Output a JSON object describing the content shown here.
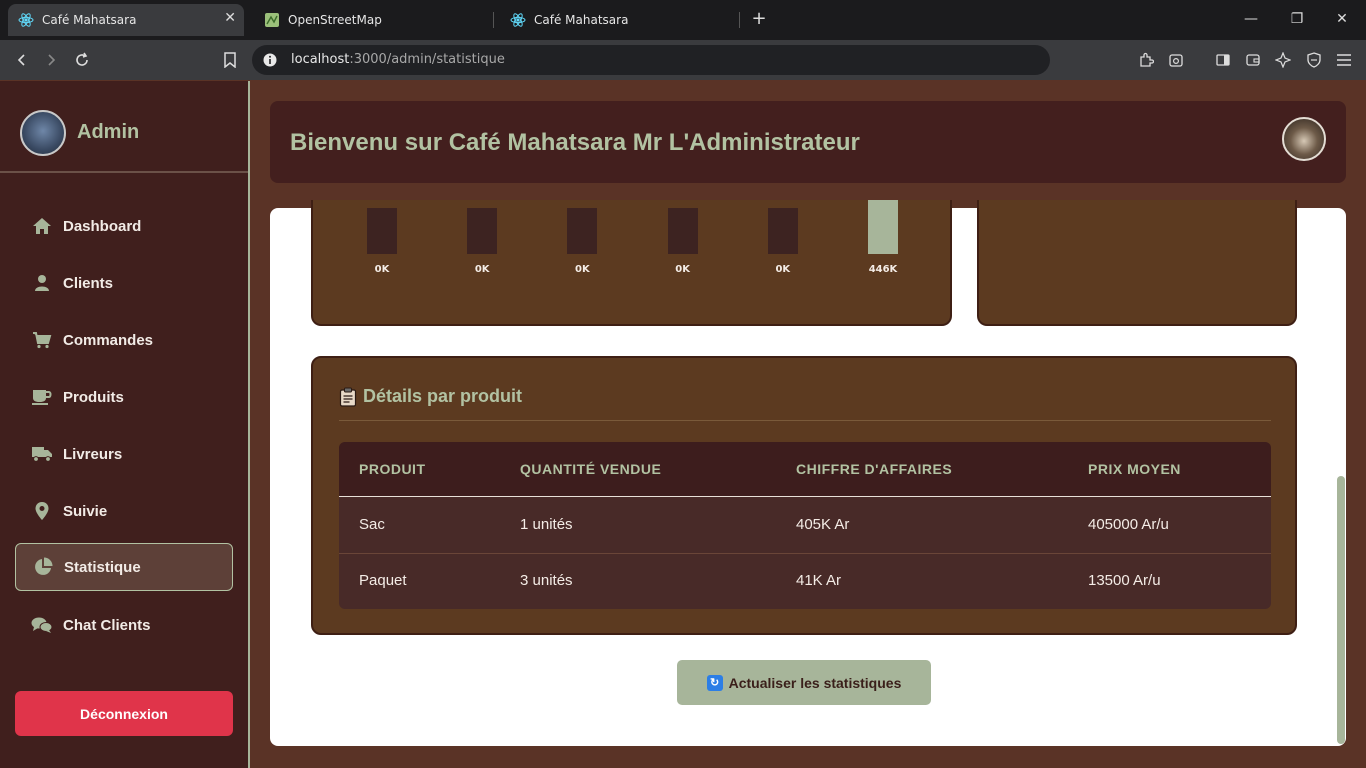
{
  "browser": {
    "tabs": [
      {
        "label": "Café Mahatsara",
        "active": true
      },
      {
        "label": "OpenStreetMap",
        "active": false
      },
      {
        "label": "Café Mahatsara",
        "active": false
      }
    ],
    "url_host": "localhost",
    "url_path": ":3000/admin/statistique"
  },
  "sidebar": {
    "admin_name": "Admin",
    "items": [
      {
        "label": "Dashboard",
        "icon": "home-icon"
      },
      {
        "label": "Clients",
        "icon": "user-icon"
      },
      {
        "label": "Commandes",
        "icon": "cart-icon"
      },
      {
        "label": "Produits",
        "icon": "coffee-icon"
      },
      {
        "label": "Livreurs",
        "icon": "truck-icon"
      },
      {
        "label": "Suivie",
        "icon": "map-pin-icon"
      },
      {
        "label": "Statistique",
        "icon": "pie-chart-icon",
        "active": true
      },
      {
        "label": "Chat Clients",
        "icon": "chat-icon"
      }
    ],
    "logout_label": "Déconnexion"
  },
  "header": {
    "title": "Bienvenu sur Café Mahatsara Mr L'Administrateur"
  },
  "chart_data": {
    "type": "bar",
    "values": [
      0,
      0,
      0,
      0,
      0,
      446
    ],
    "labels": [
      "0K",
      "0K",
      "0K",
      "0K",
      "0K",
      "446K"
    ]
  },
  "details": {
    "title": "Détails par produit",
    "columns": [
      "PRODUIT",
      "QUANTITÉ VENDUE",
      "CHIFFRE D'AFFAIRES",
      "PRIX MOYEN"
    ],
    "rows": [
      [
        "Sac",
        "1 unités",
        "405K Ar",
        "405000 Ar/u"
      ],
      [
        "Paquet",
        "3 unités",
        "41K Ar",
        "13500 Ar/u"
      ]
    ]
  },
  "refresh_label": "Actualiser les statistiques",
  "colors": {
    "accent": "#a7b59a",
    "sidebar_bg": "#401f1d",
    "card_bg": "#5c3a20",
    "danger": "#e0344a"
  }
}
